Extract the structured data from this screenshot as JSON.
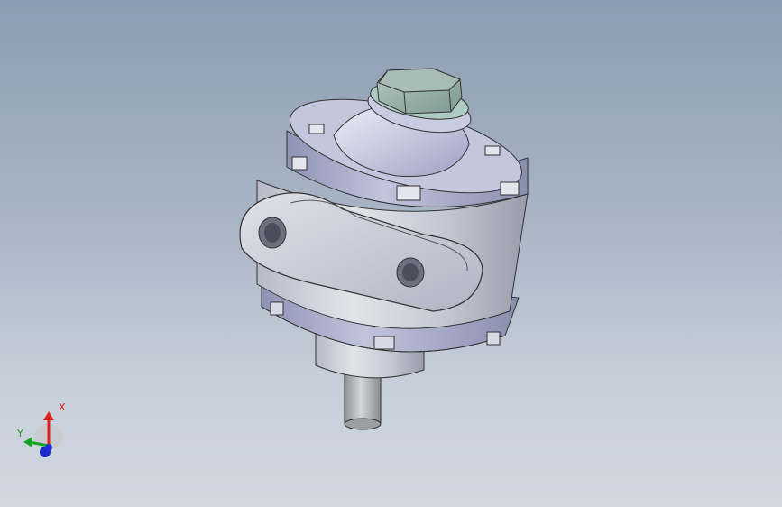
{
  "viewport": {
    "background_top": "#8c9cb2",
    "background_bottom": "#d2d8e0"
  },
  "model": {
    "body_color": "#c8cad8",
    "flange_color": "#a8abc8",
    "hex_nut_color": "#8fa8a0",
    "shaft_color": "#a8aab0"
  },
  "triad": {
    "x_label": "X",
    "y_label": "Y",
    "x_color": "#e0201c",
    "y_color": "#18a020",
    "z_color": "#1c2cc8"
  }
}
